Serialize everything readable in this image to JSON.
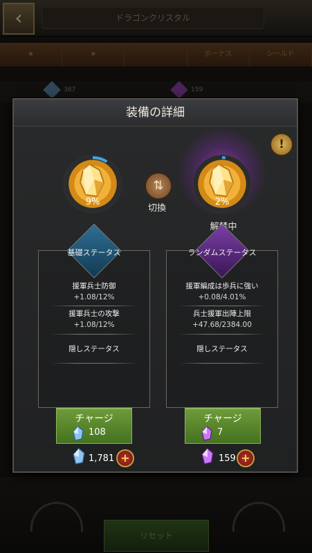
{
  "background": {
    "back_icon": "chevron-left-icon",
    "title": "ドラゴンクリスタル",
    "tabs": [
      "★",
      "★",
      "",
      "ボーナス",
      "シールド"
    ],
    "strip": {
      "blue_count": "387",
      "purple_count": "159"
    },
    "reset_label": "リセット"
  },
  "dialog": {
    "title": "装備の詳細",
    "info_icon": "exclamation-icon",
    "base_gem": {
      "percent": "9%",
      "progress": 0.09
    },
    "switch": {
      "icon": "swap-icon",
      "label": "切換"
    },
    "random_gem": {
      "percent": "2%",
      "progress": 0.02,
      "status": "解禁中"
    },
    "base_stats": {
      "header": "基礎ステータス",
      "items": [
        {
          "name": "援軍兵士防御",
          "value": "+1.08/12%"
        },
        {
          "name": "援軍兵士の攻撃",
          "value": "+1.08/12%"
        }
      ],
      "hidden": "隠しステータス",
      "charge": {
        "label": "チャージ",
        "cost": "108"
      },
      "owned": "1,781"
    },
    "random_stats": {
      "header": "ランダムステータス",
      "items": [
        {
          "name": "援軍編成は歩兵に強い",
          "value": "+0.08/4.01%"
        },
        {
          "name": "兵士援軍出陣上限",
          "value": "+47.68/2384.00"
        }
      ],
      "hidden": "隠しステータス",
      "charge": {
        "label": "チャージ",
        "cost": "7"
      },
      "owned": "159"
    }
  },
  "colors": {
    "accent_gold": "#f2b23a",
    "charge_green": "#5a8a2c",
    "blue_crystal": "#7fb6e8",
    "purple_crystal": "#c060f0"
  }
}
